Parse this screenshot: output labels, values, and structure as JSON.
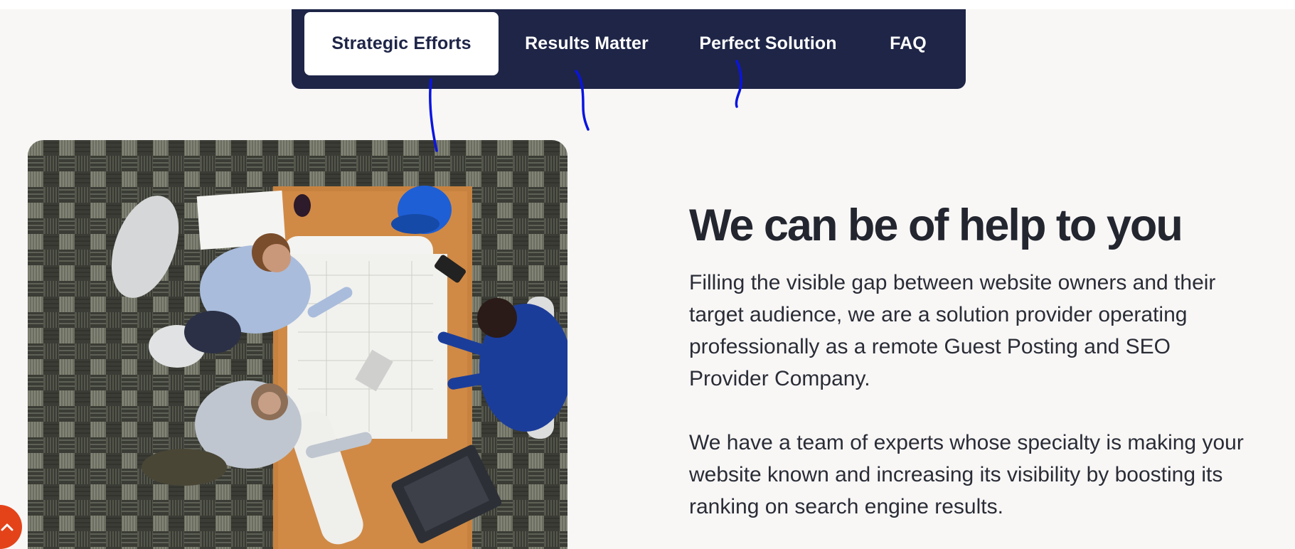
{
  "tabs": [
    {
      "label": "Strategic Efforts",
      "active": true
    },
    {
      "label": "Results Matter",
      "active": false
    },
    {
      "label": "Perfect Solution",
      "active": false
    },
    {
      "label": "FAQ",
      "active": false
    }
  ],
  "content": {
    "heading": "We can be of help to you",
    "paragraph_1": "Filling the visible gap between website owners and their target audience, we are a solution provider operating professionally as a remote Guest Posting and SEO Provider Company.",
    "paragraph_2": "We have a team of experts whose specialty is making your website known and increasing its visibility by boosting its ranking on search engine results."
  },
  "icons": {
    "scroll_top": "chevron-up-icon"
  },
  "colors": {
    "page_background": "#f8f7f6",
    "tabs_background": "#1e2547",
    "active_tab_background": "#ffffff",
    "heading_text": "#23252f",
    "scroll_top_button": "#e4431a",
    "annotation_stroke": "#0a14e0"
  }
}
